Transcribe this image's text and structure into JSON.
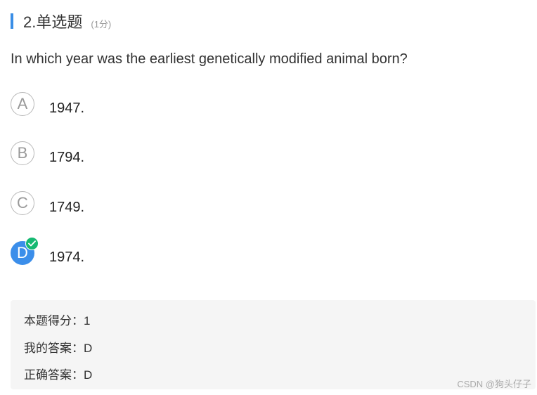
{
  "question": {
    "title": "2.单选题",
    "score": "(1分)",
    "stem": "In which year was the earliest genetically modified animal born?"
  },
  "options": [
    {
      "letter": "A",
      "text": "1947.",
      "selected": false
    },
    {
      "letter": "B",
      "text": "1794.",
      "selected": false
    },
    {
      "letter": "C",
      "text": "1749.",
      "selected": false
    },
    {
      "letter": "D",
      "text": "1974.",
      "selected": true,
      "icon": "check-icon"
    }
  ],
  "result": {
    "score_label": "本题得分：",
    "score_value": "1",
    "my_answer_label": "我的答案：",
    "my_answer_value": "D",
    "correct_answer_label": "正确答案：",
    "correct_answer_value": "D"
  },
  "watermark": "CSDN @狗头仔子",
  "colors": {
    "accent": "#3a8ee6",
    "selected": "#3b8eea",
    "correct": "#16b972",
    "panel": "#f5f5f5"
  }
}
